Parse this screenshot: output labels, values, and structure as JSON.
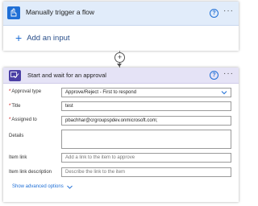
{
  "trigger": {
    "title": "Manually trigger a flow",
    "help_icon": "question-circle-icon",
    "more_icon": "ellipsis-icon",
    "add_input_label": "Add an input",
    "accent": "#1f6fd6",
    "header_bg": "#e1ecfa"
  },
  "connector": {
    "plus_icon": "plus-circle-icon",
    "plus_glyph": "+",
    "arrow_icon": "arrow-down-icon"
  },
  "approval": {
    "title": "Start and wait for an approval",
    "icon": "approval-icon",
    "accent": "#4b3fa5",
    "header_bg": "#e5e3f6",
    "fields": {
      "approval_type": {
        "label": "Approval type",
        "required": true,
        "value": "Approve/Reject - First to respond"
      },
      "title": {
        "label": "Title",
        "required": true,
        "value": "test"
      },
      "assigned_to": {
        "label": "Assigned to",
        "required": true,
        "value": "pbachhar@crgroupspdev.onmicrosoft.com;"
      },
      "details": {
        "label": "Details",
        "required": false,
        "value": ""
      },
      "item_link": {
        "label": "Item link",
        "required": false,
        "placeholder": "Add a link to the item to approve"
      },
      "item_link_description": {
        "label": "Item link description",
        "required": false,
        "placeholder": "Describe the link to the item"
      }
    },
    "show_advanced_label": "Show advanced options"
  }
}
